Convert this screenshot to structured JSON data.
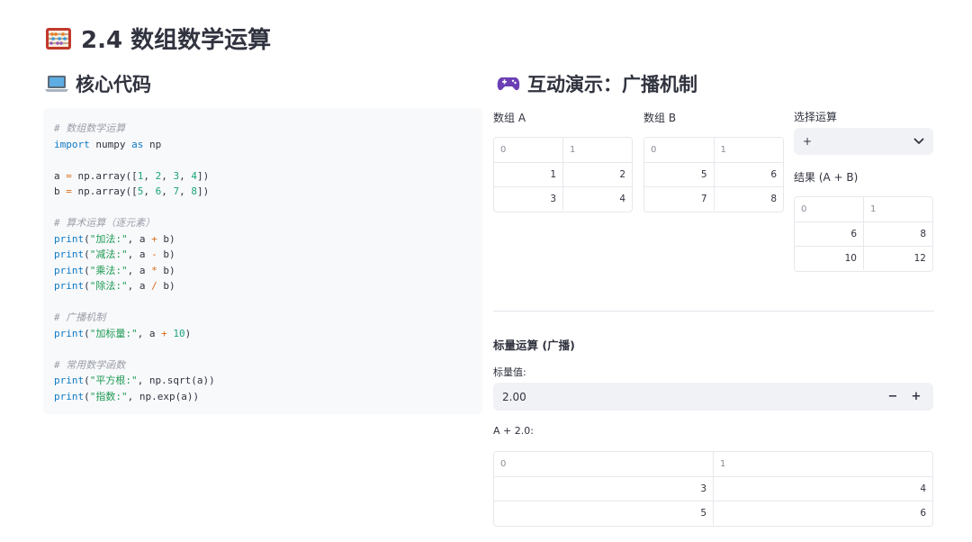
{
  "page": {
    "title": "2.4 数组数学运算",
    "title_icon": "abacus-icon"
  },
  "left": {
    "heading": "核心代码",
    "heading_icon": "laptop-icon",
    "code_lines": [
      [
        {
          "t": "c",
          "v": "# 数组数学运算"
        }
      ],
      [
        {
          "t": "k",
          "v": "import"
        },
        {
          "t": "p",
          "v": " numpy "
        },
        {
          "t": "k",
          "v": "as"
        },
        {
          "t": "p",
          "v": " np"
        }
      ],
      [],
      [
        {
          "t": "p",
          "v": "a "
        },
        {
          "t": "o",
          "v": "="
        },
        {
          "t": "p",
          "v": " np.array(["
        },
        {
          "t": "n",
          "v": "1"
        },
        {
          "t": "p",
          "v": ", "
        },
        {
          "t": "n",
          "v": "2"
        },
        {
          "t": "p",
          "v": ", "
        },
        {
          "t": "n",
          "v": "3"
        },
        {
          "t": "p",
          "v": ", "
        },
        {
          "t": "n",
          "v": "4"
        },
        {
          "t": "p",
          "v": "])"
        }
      ],
      [
        {
          "t": "p",
          "v": "b "
        },
        {
          "t": "o",
          "v": "="
        },
        {
          "t": "p",
          "v": " np.array(["
        },
        {
          "t": "n",
          "v": "5"
        },
        {
          "t": "p",
          "v": ", "
        },
        {
          "t": "n",
          "v": "6"
        },
        {
          "t": "p",
          "v": ", "
        },
        {
          "t": "n",
          "v": "7"
        },
        {
          "t": "p",
          "v": ", "
        },
        {
          "t": "n",
          "v": "8"
        },
        {
          "t": "p",
          "v": "])"
        }
      ],
      [],
      [
        {
          "t": "c",
          "v": "# 算术运算（逐元素）"
        }
      ],
      [
        {
          "t": "f",
          "v": "print"
        },
        {
          "t": "p",
          "v": "("
        },
        {
          "t": "s",
          "v": "\"加法:\""
        },
        {
          "t": "p",
          "v": ", a "
        },
        {
          "t": "o",
          "v": "+"
        },
        {
          "t": "p",
          "v": " b)"
        }
      ],
      [
        {
          "t": "f",
          "v": "print"
        },
        {
          "t": "p",
          "v": "("
        },
        {
          "t": "s",
          "v": "\"减法:\""
        },
        {
          "t": "p",
          "v": ", a "
        },
        {
          "t": "o",
          "v": "-"
        },
        {
          "t": "p",
          "v": " b)"
        }
      ],
      [
        {
          "t": "f",
          "v": "print"
        },
        {
          "t": "p",
          "v": "("
        },
        {
          "t": "s",
          "v": "\"乘法:\""
        },
        {
          "t": "p",
          "v": ", a "
        },
        {
          "t": "o",
          "v": "*"
        },
        {
          "t": "p",
          "v": " b)"
        }
      ],
      [
        {
          "t": "f",
          "v": "print"
        },
        {
          "t": "p",
          "v": "("
        },
        {
          "t": "s",
          "v": "\"除法:\""
        },
        {
          "t": "p",
          "v": ", a "
        },
        {
          "t": "o",
          "v": "/"
        },
        {
          "t": "p",
          "v": " b)"
        }
      ],
      [],
      [
        {
          "t": "c",
          "v": "# 广播机制"
        }
      ],
      [
        {
          "t": "f",
          "v": "print"
        },
        {
          "t": "p",
          "v": "("
        },
        {
          "t": "s",
          "v": "\"加标量:\""
        },
        {
          "t": "p",
          "v": ", a "
        },
        {
          "t": "o",
          "v": "+"
        },
        {
          "t": "p",
          "v": " "
        },
        {
          "t": "n",
          "v": "10"
        },
        {
          "t": "p",
          "v": ")"
        }
      ],
      [],
      [
        {
          "t": "c",
          "v": "# 常用数学函数"
        }
      ],
      [
        {
          "t": "f",
          "v": "print"
        },
        {
          "t": "p",
          "v": "("
        },
        {
          "t": "s",
          "v": "\"平方根:\""
        },
        {
          "t": "p",
          "v": ", np.sqrt(a))"
        }
      ],
      [
        {
          "t": "f",
          "v": "print"
        },
        {
          "t": "p",
          "v": "("
        },
        {
          "t": "s",
          "v": "\"指数:\""
        },
        {
          "t": "p",
          "v": ", np.exp(a))"
        }
      ]
    ]
  },
  "right": {
    "heading": "互动演示：广播机制",
    "heading_icon": "gamepad-icon",
    "array_a": {
      "label": "数组 A",
      "headers": [
        "0",
        "1"
      ],
      "rows": [
        [
          "1",
          "2"
        ],
        [
          "3",
          "4"
        ]
      ]
    },
    "array_b": {
      "label": "数组 B",
      "headers": [
        "0",
        "1"
      ],
      "rows": [
        [
          "5",
          "6"
        ],
        [
          "7",
          "8"
        ]
      ]
    },
    "operation": {
      "label": "选择运算",
      "value": "+"
    },
    "result": {
      "label": "结果 (A + B)",
      "headers": [
        "0",
        "1"
      ],
      "rows": [
        [
          "6",
          "8"
        ],
        [
          "10",
          "12"
        ]
      ]
    },
    "scalar": {
      "heading": "标量运算 (广播)",
      "label": "标量值:",
      "value": "2.00",
      "minus": "−",
      "plus": "+",
      "result_label": "A + 2.0:",
      "headers": [
        "0",
        "1"
      ],
      "rows": [
        [
          "3",
          "4"
        ],
        [
          "5",
          "6"
        ]
      ]
    }
  },
  "colors": {
    "text": "#31333f",
    "input_bg": "#f0f2f6",
    "code_bg": "#f8f9fb",
    "border": "#e6e8ec"
  }
}
